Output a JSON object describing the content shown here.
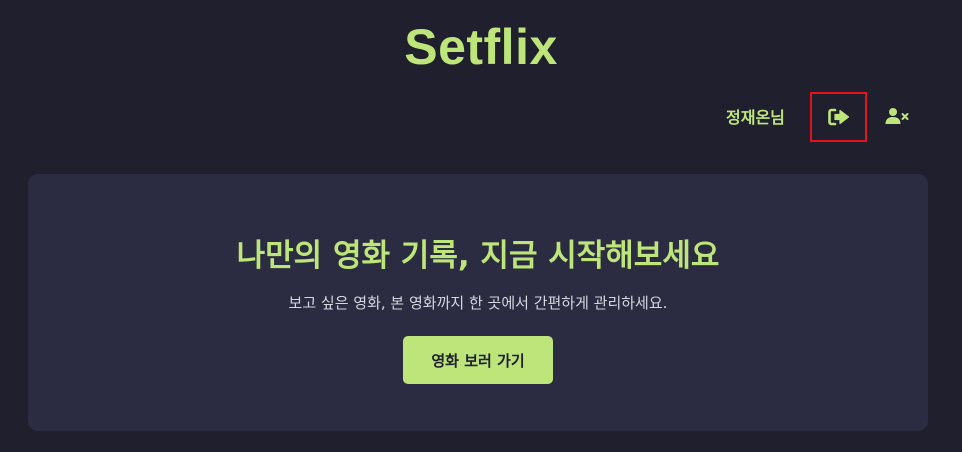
{
  "header": {
    "logo": "Setflix",
    "username": "정재온님",
    "icons": {
      "logout": "sign-out-icon",
      "withdraw": "user-remove-icon"
    },
    "accent_color": "#bde57a",
    "highlight_border_color": "#e3121b"
  },
  "hero": {
    "title": "나만의 영화 기록, 지금 시작해보세요",
    "subtitle": "보고 싶은 영화, 본 영화까지 한 곳에서 간편하게 관리하세요.",
    "cta_label": "영화 보러 가기"
  }
}
